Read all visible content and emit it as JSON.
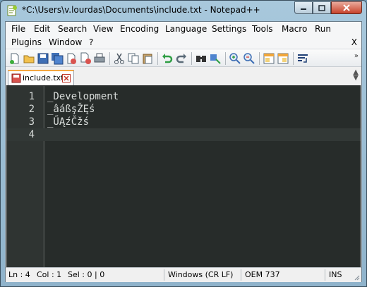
{
  "window": {
    "title": "*C:\\Users\\v.lourdas\\Documents\\include.txt - Notepad++"
  },
  "menu": {
    "row1": [
      "File",
      "Edit",
      "Search",
      "View",
      "Encoding",
      "Language",
      "Settings",
      "Tools",
      "Macro",
      "Run"
    ],
    "row2": [
      "Plugins",
      "Window",
      "?"
    ],
    "close_doc": "X"
  },
  "toolbar": {
    "icons": [
      "new-file-icon",
      "open-file-icon",
      "save-icon",
      "save-all-icon",
      "close-icon",
      "close-all-icon",
      "print-icon",
      "cut-icon",
      "copy-icon",
      "paste-icon",
      "undo-icon",
      "redo-icon",
      "find-icon",
      "replace-icon",
      "zoom-in-icon",
      "zoom-out-icon",
      "sync-vertical-icon",
      "sync-horizontal-icon",
      "word-wrap-icon"
    ]
  },
  "tab": {
    "label": "include.txt"
  },
  "editor": {
    "lines": [
      {
        "num": "1",
        "text": "_Development"
      },
      {
        "num": "2",
        "text": "_âáßşŽĘś"
      },
      {
        "num": "3",
        "text": "_ŰĄźČžś"
      },
      {
        "num": "4",
        "text": ""
      }
    ],
    "current_line": 4
  },
  "status": {
    "ln": "Ln : 4",
    "col": "Col : 1",
    "sel": "Sel : 0 | 0",
    "eol": "Windows (CR LF)",
    "encoding": "OEM 737",
    "mode": "INS"
  },
  "colors": {
    "editor_bg": "#272c2a",
    "tab_accent": "#f4a640",
    "close_button": "#c8422a"
  }
}
